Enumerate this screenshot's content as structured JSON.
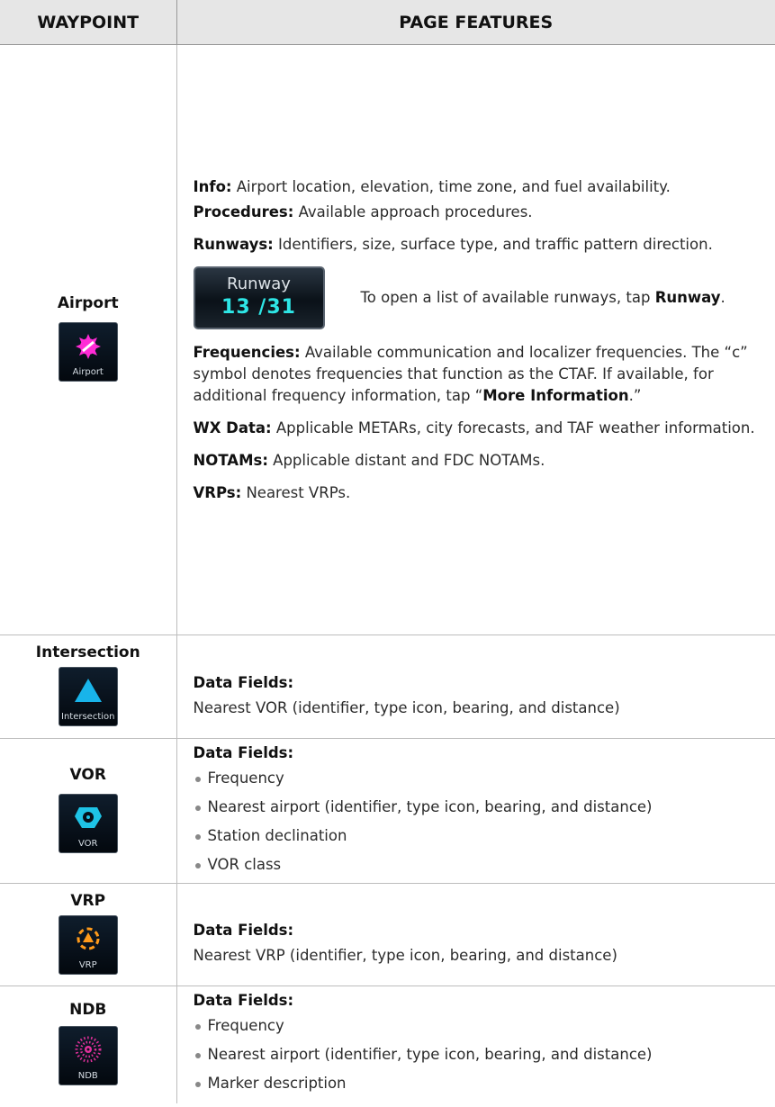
{
  "header": {
    "col1": "WAYPOINT",
    "col2": "PAGE FEATURES"
  },
  "airport": {
    "name": "Airport",
    "icon_label": "Airport",
    "info_label": "Info:",
    "info_text": " Airport location, elevation, time zone, and fuel availability.",
    "proc_label": "Procedures:",
    "proc_text": " Available approach procedures.",
    "rwys_label": "Runways:",
    "rwys_text": " Identifiers, size, surface type, and traffic pattern direction.",
    "runway_button": {
      "title": "Runway",
      "value": "13 /31"
    },
    "runway_desc_pre": "To open a list of available runways, tap ",
    "runway_desc_bold": "Runway",
    "runway_desc_post": ".",
    "freq_label": "Frequencies:",
    "freq_text": " Available communication and localizer frequencies. The “c” symbol denotes frequencies that function as the CTAF. If available, for additional frequency information, tap “",
    "freq_bold": "More Information",
    "freq_end": ".”",
    "wx_label": "WX Data:",
    "wx_text": " Applicable METARs, city forecasts, and TAF weather information.",
    "notam_label": "NOTAMs:",
    "notam_text": " Applicable distant and FDC NOTAMs.",
    "vrp_label": "VRPs:",
    "vrp_text": " Nearest VRPs."
  },
  "intersection": {
    "name": "Intersection",
    "icon_label": "Intersection",
    "fields_label": "Data Fields:",
    "line": "Nearest VOR (identifier, type icon, bearing, and distance)"
  },
  "vor": {
    "name": "VOR",
    "icon_label": "VOR",
    "fields_label": "Data Fields:",
    "items": [
      "Frequency",
      "Nearest airport (identifier, type icon, bearing, and distance)",
      "Station declination",
      "VOR class"
    ]
  },
  "vrp": {
    "name": "VRP",
    "icon_label": "VRP",
    "fields_label": "Data Fields:",
    "line": "Nearest VRP (identifier, type icon, bearing, and distance)"
  },
  "ndb": {
    "name": "NDB",
    "icon_label": "NDB",
    "fields_label": "Data Fields:",
    "items": [
      "Frequency",
      "Nearest airport (identifier, type icon, bearing, and distance)",
      "Marker description"
    ]
  },
  "colors": {
    "airport_icon": "#ff2bd6",
    "intersection_icon": "#18b4ea",
    "vor_icon": "#1ec3e6",
    "vrp_icon": "#ff9a1a",
    "ndb_icon": "#e0309a",
    "runway_value": "#2ee6e6"
  }
}
